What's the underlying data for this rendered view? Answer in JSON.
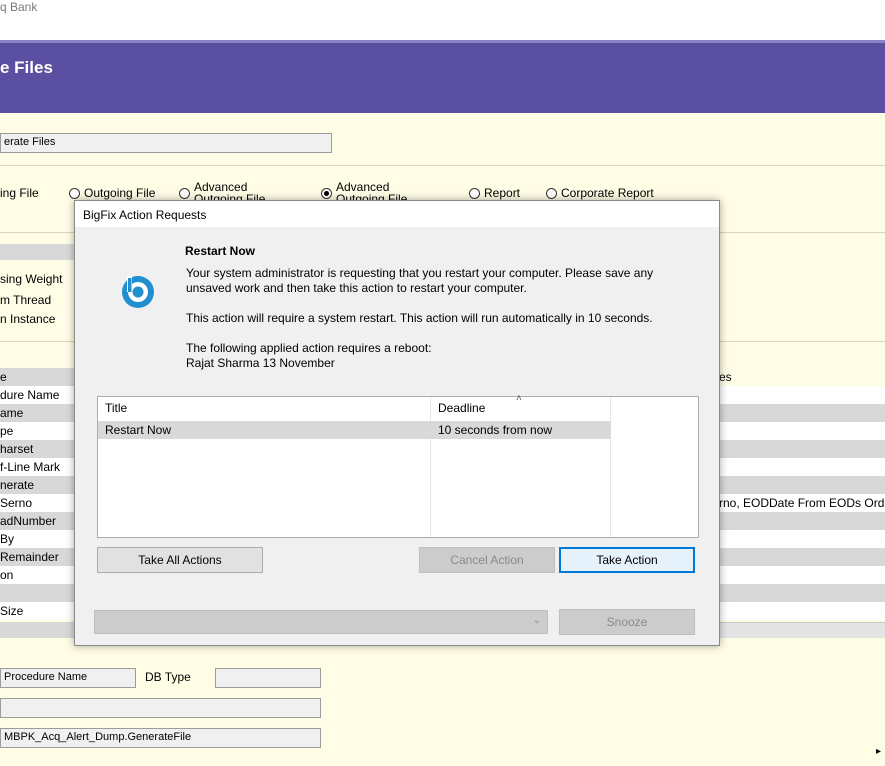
{
  "app": {
    "title_fragment": "q Bank",
    "page_title": "e Files",
    "generate_field_value": "erate Files"
  },
  "radio_options": [
    {
      "label": "ing File",
      "selected": false,
      "has_button": false
    },
    {
      "label": "Outgoing File",
      "selected": false,
      "has_button": true
    },
    {
      "label": "Advanced Outgoing File",
      "selected": false,
      "has_button": true
    },
    {
      "label": "Advanced Outgoing File (pipeline)",
      "selected": true,
      "has_button": true
    },
    {
      "label": "Report",
      "selected": false,
      "has_button": true
    },
    {
      "label": "Corporate Report",
      "selected": false,
      "has_button": true
    }
  ],
  "side_labels": [
    "sing Weight",
    "m Thread",
    "n Instance"
  ],
  "grid_left_rows": [
    "e",
    "dure Name",
    "ame",
    "pe",
    "harset",
    "f-Line Mark",
    "nerate",
    "Serno",
    "adNumber",
    "By",
    "Remainder",
    "on",
    "",
    "Size"
  ],
  "grid_right": {
    "header": "es",
    "value_row": "rno, EODDate From EODs Ord"
  },
  "bottom_form": {
    "procedure_name_field": "Procedure Name",
    "db_type_label": "DB Type",
    "db_type_value": "",
    "empty_field": "",
    "procedure_value": "MBPK_Acq_Alert_Dump.GenerateFile"
  },
  "dialog": {
    "title": "BigFix Action Requests",
    "heading": "Restart Now",
    "paragraph1": "Your system administrator is requesting that you restart your computer.  Please save any unsaved work and then take this action to restart your computer.",
    "paragraph2": "This action will require a system restart.  This action will run automatically in 10 seconds.",
    "paragraph3_line1": "The following applied action requires a reboot:",
    "paragraph3_line2": "Rajat Sharma 13 November",
    "table": {
      "columns": [
        "Title",
        "Deadline"
      ],
      "rows": [
        {
          "title": "Restart Now",
          "deadline": "10 seconds from now"
        }
      ]
    },
    "buttons": {
      "take_all": "Take All Actions",
      "cancel": "Cancel Action",
      "take": "Take Action",
      "snooze": "Snooze"
    },
    "snooze_select_value": "",
    "colors": {
      "accent": "#0078d7",
      "brand": "#1f8fd0"
    }
  },
  "colors": {
    "header_band": "#5a4fa0",
    "background": "#fffde6"
  }
}
